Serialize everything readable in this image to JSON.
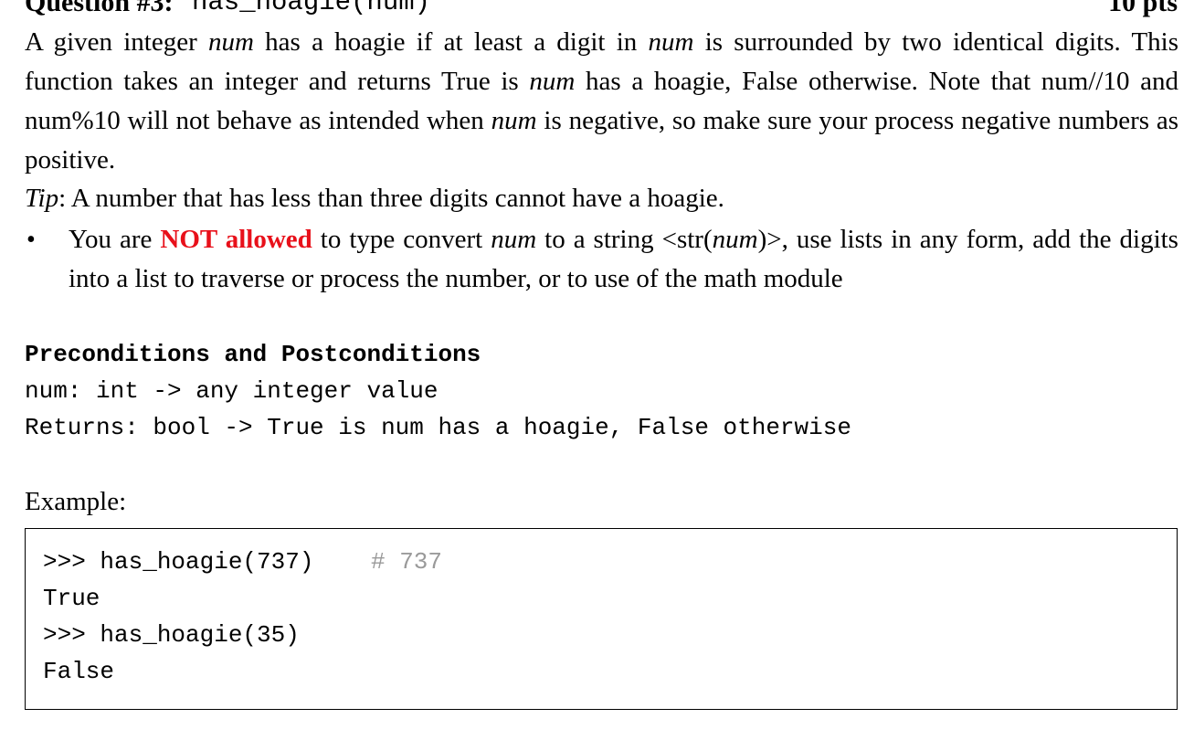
{
  "header": {
    "question_label": "Question #3:",
    "function_signature": "has_hoagie(num)",
    "points": "10 pts"
  },
  "description": {
    "p1_a": "A given integer ",
    "p1_num1": "num",
    "p1_b": " has a hoagie if at least a digit in ",
    "p1_num2": "num",
    "p1_c": " is surrounded by two identical digits. This function takes an integer and returns True is ",
    "p1_num3": "num",
    "p1_d": " has a hoagie, False otherwise. Note that num//10 and num%10 will not behave as intended when ",
    "p1_num4": "num",
    "p1_e": " is negative, so make sure your process negative numbers as positive."
  },
  "tip": {
    "label": "Tip",
    "text": ": A number that has less than three digits cannot have a hoagie."
  },
  "bullet": {
    "dot": "•",
    "a": "You are ",
    "emphasis": "NOT allowed",
    "b": " to type convert ",
    "num1": "num",
    "c": " to a string <str(",
    "num2": "num",
    "d": ")>, use lists in any form, add the digits into a list to traverse or process the number, or to use of the math module"
  },
  "conditions": {
    "title": "Preconditions and Postconditions",
    "line1": "num: int -> any integer value",
    "line2": "Returns: bool -> True is num has a hoagie, False otherwise"
  },
  "example": {
    "label": "Example:",
    "lines": [
      ">>> has_hoagie(737)",
      "True",
      ">>> has_hoagie(35)",
      "False"
    ],
    "comment": "# 737"
  },
  "colors": {
    "emphasis_red": "#e8101a",
    "comment_gray": "#9a9a9a"
  }
}
